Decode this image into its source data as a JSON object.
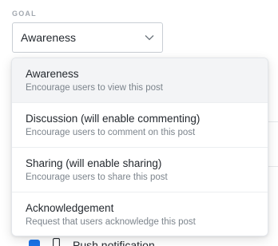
{
  "goal": {
    "label": "GOAL",
    "selected_value": "Awareness"
  },
  "options": [
    {
      "title": "Awareness",
      "description": "Encourage users to view this post",
      "selected": true
    },
    {
      "title": "Discussion (will enable commenting)",
      "description": "Encourage users to comment on this post",
      "selected": false
    },
    {
      "title": "Sharing (will enable sharing)",
      "description": "Encourage users to share this post",
      "selected": false
    },
    {
      "title": "Acknowledgement",
      "description": "Request that users acknowledge this post",
      "selected": false
    }
  ],
  "background": {
    "partial_option_label": "Push notification",
    "checkbox_color": "#1a73e8"
  }
}
